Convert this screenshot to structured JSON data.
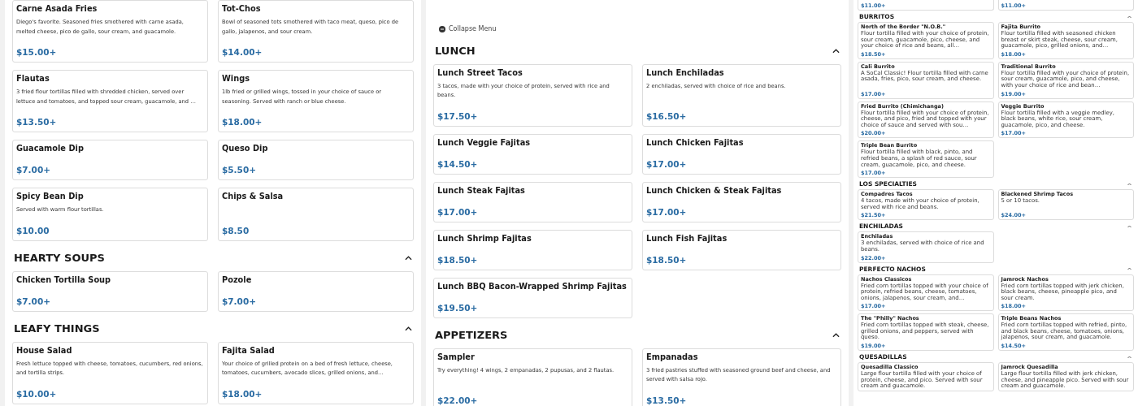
{
  "panels": [
    {
      "kind": "full",
      "sections": [
        {
          "items": [
            {
              "name": "Carne Asada Fries",
              "description": "Diego's favorite. Seasoned fries smothered with carne asada, melted cheese, pico de gallo, sour cream, and guacamole.",
              "price": "$15.00+"
            },
            {
              "name": "Tot-Chos",
              "description": "Bowl of seasoned tots smothered with taco meat, queso, pico de gallo, jalapenos, and sour cream.",
              "price": "$14.00+"
            },
            {
              "name": "Flautas",
              "description": "3 fried flour tortillas filled with shredded chicken, served over lettuce and tomatoes, and topped sour cream, guacamole, and …",
              "price": "$13.50+"
            },
            {
              "name": "Wings",
              "description": "1lb fried or grilled wings, tossed in your choice of sauce or seasoning. Served with ranch or blue cheese.",
              "price": "$18.00+"
            },
            {
              "name": "Guacamole Dip",
              "price": "$7.00+"
            },
            {
              "name": "Queso Dip",
              "price": "$5.50+"
            },
            {
              "name": "Spicy Bean Dip",
              "description": "Served with warm flour tortillas.",
              "price": "$10.00"
            },
            {
              "name": "Chips & Salsa",
              "price": "$8.50"
            }
          ]
        },
        {
          "title": "HEARTY SOUPS",
          "expanded": true,
          "items": [
            {
              "name": "Chicken Tortilla Soup",
              "price": "$7.00+"
            },
            {
              "name": "Pozole",
              "price": "$7.00+"
            }
          ]
        },
        {
          "title": "LEAFY THINGS",
          "expanded": true,
          "items": [
            {
              "name": "House Salad",
              "description": "Fresh lettuce topped with cheese, tomatoes, cucumbers, red onions, and tortilla strips.",
              "price": "$10.00+"
            },
            {
              "name": "Fajita Salad",
              "description": "Your choice of grilled protein on a bed of fresh lettuce, cheese, tomatoes, cucumbers, avocado slices, grilled onions, and…",
              "price": "$18.00+"
            }
          ]
        }
      ]
    },
    {
      "kind": "full",
      "collapse_menu": "Collapse Menu",
      "sections": [
        {
          "title": "LUNCH",
          "expanded": true,
          "items": [
            {
              "name": "Lunch Street Tacos",
              "description": "3 tacos, made with your choice of protein, served with rice and beans.",
              "price": "$17.50+"
            },
            {
              "name": "Lunch Enchiladas",
              "description": "2 enchiladas, served with choice of rice and beans.",
              "price": "$16.50+"
            },
            {
              "name": "Lunch Veggie Fajitas",
              "price": "$14.50+"
            },
            {
              "name": "Lunch Chicken Fajitas",
              "price": "$17.00+"
            },
            {
              "name": "Lunch Steak Fajitas",
              "price": "$17.00+"
            },
            {
              "name": "Lunch Chicken & Steak Fajitas",
              "price": "$17.00+"
            },
            {
              "name": "Lunch Shrimp Fajitas",
              "price": "$18.50+"
            },
            {
              "name": "Lunch Fish Fajitas",
              "price": "$18.50+"
            },
            {
              "name": "Lunch BBQ Bacon-Wrapped Shrimp Fajitas",
              "price": "$19.50+"
            }
          ]
        },
        {
          "title": "APPETIZERS",
          "expanded": true,
          "items": [
            {
              "name": "Sampler",
              "description": "Try everything! 4 wings, 2 empanadas, 2 pupusas, and 2 flautas.",
              "price": "$22.00+"
            },
            {
              "name": "Empanadas",
              "description": "3 fried pastries stuffed with seasoned ground beef and cheese, and served with salsa rojo.",
              "price": "$13.50+"
            }
          ]
        }
      ]
    },
    {
      "kind": "compact",
      "sections": [
        {
          "items": [
            {
              "price": "$11.00+"
            },
            {
              "price": "$11.00+"
            }
          ]
        },
        {
          "title": "BURRITOS",
          "expanded": true,
          "items": [
            {
              "name": "North of the Border \"N.O.B.\"",
              "description": "Flour tortilla filled with your choice of protein, sour cream, guacamole, pico, cheese, and your choice of rice and beans, all…",
              "price": "$18.50+"
            },
            {
              "name": "Fajita Burrito",
              "description": "Flour tortilla filled with seasoned chicken breast or skirt steak, cheese, sour cream, guacamole, pico, grilled onions, and…",
              "price": "$18.00+"
            },
            {
              "name": "Cali Burrito",
              "description": "A SoCal Classic! Flour tortilla filled with carne asada, fries, pico, sour cream, and cheese.",
              "price": "$17.00+"
            },
            {
              "name": "Traditional Burrito",
              "description": "Flour tortilla filled with your choice of protein, sour cream, guacamole, pico, and cheese, with your choice of rice and bean…",
              "price": "$19.00+"
            },
            {
              "name": "Fried Burrito (Chimichanga)",
              "description": "Flour tortilla filled with your choice of protein, cheese, and pico, fried and topped with your choice of sauce and served with sou…",
              "price": "$20.00+"
            },
            {
              "name": "Veggie Burrito",
              "description": "Flour tortilla filled with a veggie medley, black beans, white rice, sour cream, guacamole, pico, and cheese.",
              "price": "$17.00+"
            },
            {
              "name": "Triple Bean Burrito",
              "description": "Flour tortilla filled with black, pinto, and refried beans, a splash of red sauce, sour cream, guacamole, pico, and cheese.",
              "price": "$17.00+"
            }
          ]
        },
        {
          "title": "LOS SPECIALTIES",
          "expanded": true,
          "items": [
            {
              "name": "Compadres Tacos",
              "description": "4 tacos, made with your choice of protein, served with rice and beans.",
              "price": "$21.50+"
            },
            {
              "name": "Blackened Shrimp Tacos",
              "description": "5 or 10 tacos.",
              "price": "$24.00+"
            }
          ]
        },
        {
          "title": "ENCHILADAS",
          "expanded": true,
          "items": [
            {
              "name": "Enchiladas",
              "description": "3 enchiladas, served with choice of rice and beans.",
              "price": "$22.00+"
            }
          ]
        },
        {
          "title": "PERFECTO NACHOS",
          "expanded": true,
          "items": [
            {
              "name": "Nachos Classicos",
              "description": "Fried corn tortillas topped with your choice of protein, refried beans, cheese, tomatoes, onions, jalapenos, sour cream, and…",
              "price": "$17.00+"
            },
            {
              "name": "Jamrock Nachos",
              "description": "Fried corn tortillas topped with jerk chicken, black beans, cheese, pineapple pico, and sour cream.",
              "price": "$18.00+"
            },
            {
              "name": "The \"Philly\" Nachos",
              "description": "Fried corn tortillas topped with steak, cheese, grilled onions, and peppers, served with queso.",
              "price": "$19.00+"
            },
            {
              "name": "Triple Beans Nachos",
              "description": "Fried corn tortillas topped with refried, pinto, and black beans, cheese, tomatoes, onions, jalapenos, sour cream, and guacamole.",
              "price": "$14.50+"
            }
          ]
        },
        {
          "title": "QUESADILLAS",
          "expanded": true,
          "items": [
            {
              "name": "Quesadilla Classico",
              "description": "Large flour tortilla filled with your choice of protein, cheese, and pico. Served with sour cream and guacamole."
            },
            {
              "name": "Jamrock Quesadilla",
              "description": "Large flour tortilla filled with jerk chicken, cheese, and pineapple pico. Served with sour cream and guacamole."
            }
          ]
        }
      ]
    }
  ]
}
